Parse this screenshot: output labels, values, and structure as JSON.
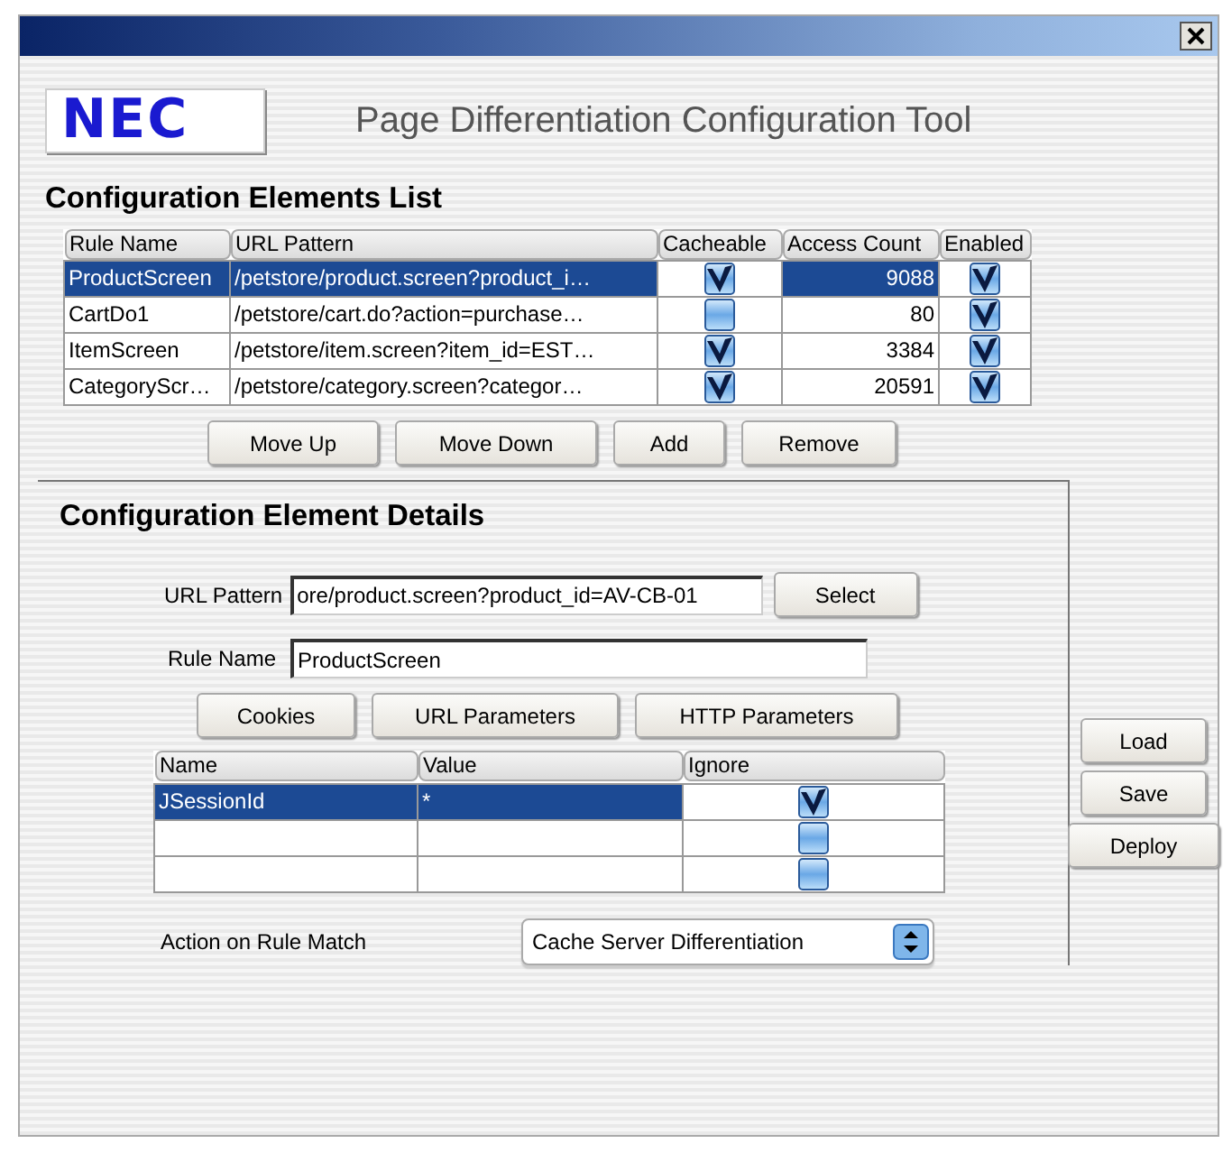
{
  "logo": "NEC",
  "title": "Page Differentiation Configuration Tool",
  "elements_list": {
    "heading": "Configuration Elements List",
    "columns": [
      "Rule Name",
      "URL Pattern",
      "Cacheable",
      "Access Count",
      "Enabled"
    ],
    "rows": [
      {
        "rule_name": "ProductScreen",
        "url_pattern": "/petstore/product.screen?product_i…",
        "cacheable": true,
        "access_count": "9088",
        "enabled": true,
        "selected": true
      },
      {
        "rule_name": "CartDo1",
        "url_pattern": "/petstore/cart.do?action=purchase…",
        "cacheable": false,
        "access_count": "80",
        "enabled": true,
        "selected": false
      },
      {
        "rule_name": "ItemScreen",
        "url_pattern": "/petstore/item.screen?item_id=EST…",
        "cacheable": true,
        "access_count": "3384",
        "enabled": true,
        "selected": false
      },
      {
        "rule_name": "CategoryScr…",
        "url_pattern": "/petstore/category.screen?categor…",
        "cacheable": true,
        "access_count": "20591",
        "enabled": true,
        "selected": false
      }
    ],
    "buttons": [
      "Move Up",
      "Move Down",
      "Add",
      "Remove"
    ]
  },
  "details": {
    "heading": "Configuration Element Details",
    "url_pattern": {
      "label": "URL Pattern",
      "value": "ore/product.screen?product_id=AV-CB-01"
    },
    "select_button": "Select",
    "rule_name": {
      "label": "Rule Name",
      "value": "ProductScreen"
    },
    "buttons": [
      "Cookies",
      "URL Parameters",
      "HTTP Parameters"
    ],
    "parameters": {
      "columns": [
        "Name",
        "Value",
        "Ignore"
      ],
      "rows": [
        {
          "name": "JSessionId",
          "value": "*",
          "ignore": true,
          "selected": true
        },
        {
          "ignore": false,
          "selected": false
        },
        {
          "ignore": false,
          "selected": false
        }
      ]
    },
    "action": {
      "label": "Action on Rule Match",
      "value": "Cache Server Differentiation"
    }
  },
  "side_buttons": [
    "Load",
    "Save",
    "Deploy"
  ]
}
